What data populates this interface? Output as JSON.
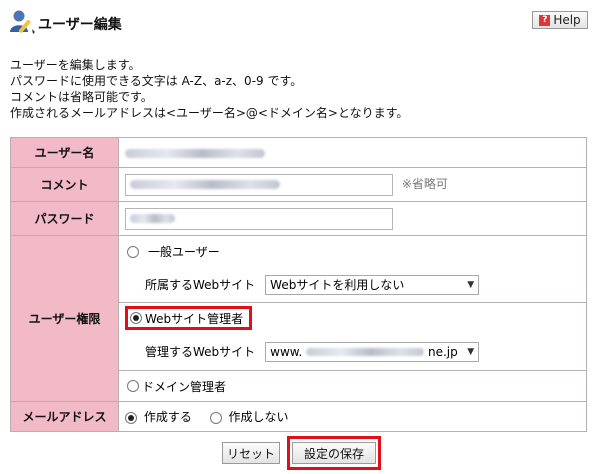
{
  "header": {
    "title": "ユーザー編集",
    "help_label": "Help",
    "help_glyph": "?"
  },
  "intro": {
    "lines": [
      "ユーザーを編集します。",
      "パスワードに使用できる文字は A-Z、a-z、0-9 です。",
      "コメントは省略可能です。",
      "作成されるメールアドレスは<ユーザー名>@<ドメイン名>となります。"
    ]
  },
  "form": {
    "username": {
      "label": "ユーザー名"
    },
    "comment": {
      "label": "コメント",
      "note": "※省略可"
    },
    "password": {
      "label": "パスワード"
    },
    "role": {
      "label": "ユーザー権限",
      "general_user": "一般ユーザー",
      "affiliated_site_label": "所属するWebサイト",
      "affiliated_site_value": "Webサイトを利用しない",
      "site_admin": "Webサイト管理者",
      "managed_site_label": "管理するWebサイト",
      "managed_site_prefix": "www.",
      "managed_site_suffix": "ne.jp",
      "domain_admin": "ドメイン管理者",
      "selected": "site_admin"
    },
    "mail": {
      "label": "メールアドレス",
      "create": "作成する",
      "no_create": "作成しない",
      "selected": "create"
    }
  },
  "buttons": {
    "reset": "リセット",
    "save": "設定の保存"
  },
  "colors": {
    "label_bg": "#f2b9c7",
    "highlight": "#e0101a"
  }
}
